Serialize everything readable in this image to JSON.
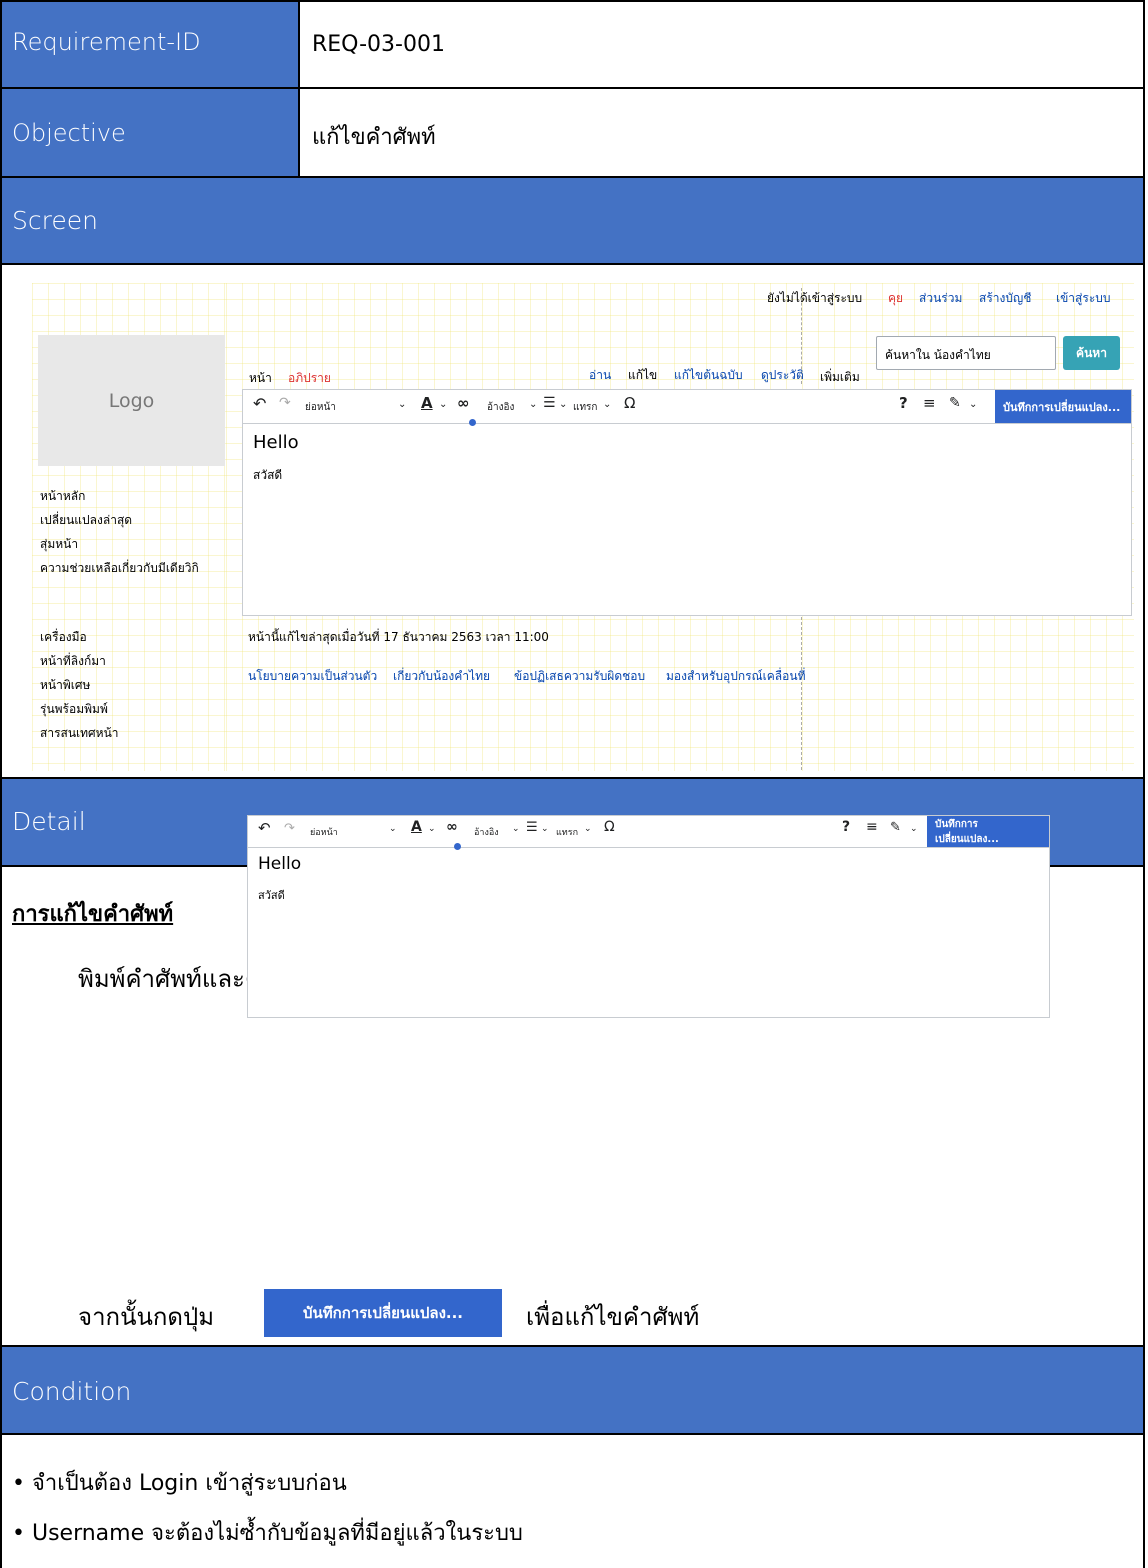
{
  "requirement": {
    "label": "Requirement-ID",
    "value": "REQ-03-001"
  },
  "objective": {
    "label": "Objective",
    "value": "แก้ไขคำศัพท์"
  },
  "screen": {
    "label": "Screen",
    "userbar": {
      "not_logged_in": "ยังไม่ได้เข้าสู่ระบบ",
      "talk": "คุย",
      "contributions": "ส่วนร่วม",
      "create_account": "สร้างบัญชี",
      "login": "เข้าสู่ระบบ"
    },
    "logo": "Logo",
    "tabs": {
      "page": "หน้า",
      "discussion": "อภิปราย",
      "read": "อ่าน",
      "edit": "แก้ไข",
      "edit_source": "แก้ไขต้นฉบับ",
      "history": "ดูประวัติ",
      "more": "เพิ่มเติม"
    },
    "search": {
      "placeholder": "ค้นหาใน น้องคำไทย",
      "button": "ค้นหา"
    },
    "sidebar": {
      "nav": [
        "หน้าหลัก",
        "เปลี่ยนแปลงล่าสุด",
        "สุ่มหน้า",
        "ความช่วยเหลือเกี่ยวกับมีเดียวิกิ"
      ],
      "tools": [
        "เครื่องมือ",
        "หน้าที่ลิงก์มา",
        "หน้าพิเศษ",
        "รุ่นพร้อมพิมพ์",
        "สารสนเทศหน้า"
      ]
    },
    "editor": {
      "heading_select": "ย่อหน้า",
      "cite": "อ้างอิง",
      "insert": "แทรก",
      "save": "บันทึกการเปลี่ยนแปลง...",
      "heading_text": "Hello",
      "body_text": "สวัสดี"
    },
    "last_edited": "หน้านี้แก้ไขล่าสุดเมื่อวันที่ 17 ธันวาคม 2563 เวลา 11:00",
    "footer_links": [
      "นโยบายความเป็นส่วนตัว",
      "เกี่ยวกับน้องคำไทย",
      "ข้อปฏิเสธความรับผิดชอบ",
      "มองสำหรับอุปกรณ์เคลื่อนที่"
    ]
  },
  "detail": {
    "label": "Detail",
    "title": "การแก้ไขคำศัพท์",
    "step1": "พิมพ์คำศัพท์และคำอธิบายที่ต้องการแก้ไขใน",
    "editor": {
      "heading_select": "ย่อหน้า",
      "cite": "อ้างอิง",
      "insert": "แทรก",
      "save": "บันทึกการเปลี่ยนแปลง...",
      "heading_text": "Hello",
      "body_text": "สวัสดี"
    },
    "step2_prefix": "จากนั้นกดปุ่ม",
    "step2_button": "บันทึกการเปลี่ยนแปลง...",
    "step2_suffix": "เพื่อแก้ไขคำศัพท์"
  },
  "condition": {
    "label": "Condition",
    "items": [
      "• จำเป็นต้อง Login เข้าสู่ระบบก่อน",
      "• Username จะต้องไม่ซ้ำกับข้อมูลที่มีอยู่แล้วในระบบ"
    ]
  }
}
